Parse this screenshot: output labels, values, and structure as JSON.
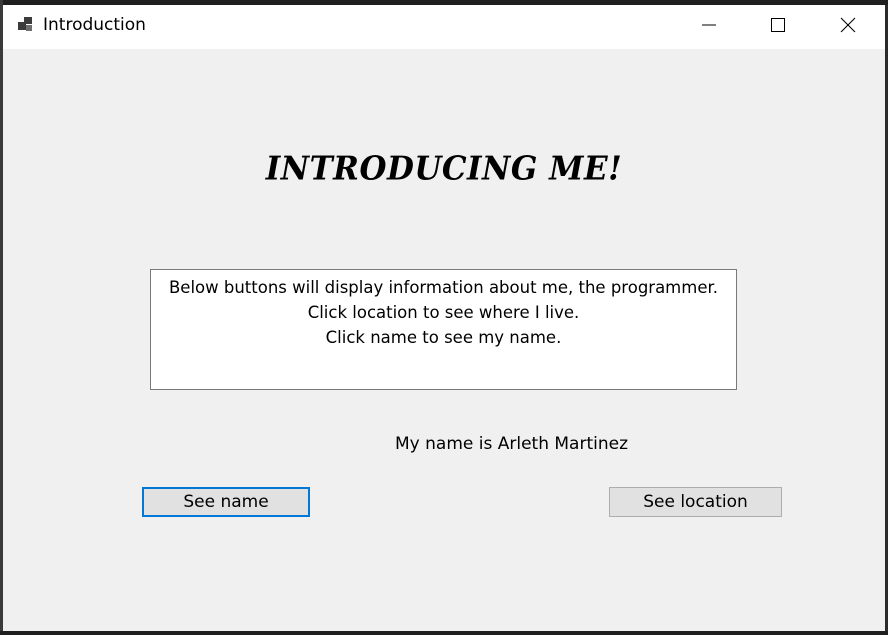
{
  "window": {
    "title": "Introduction",
    "controls": {
      "minimize_icon": "minimize-icon",
      "maximize_icon": "maximize-icon",
      "close_icon": "close-icon"
    }
  },
  "main": {
    "heading": "INTRODUCING ME!",
    "info_lines": [
      "Below buttons will display information about me, the programmer.",
      "Click location to see where I live.",
      "Click name to see my name."
    ],
    "result_label": "My name is Arleth Martinez",
    "buttons": {
      "see_name": "See name",
      "see_location": "See location"
    }
  },
  "colors": {
    "focus_border": "#0078d7",
    "form_background": "#f0f0f0",
    "button_background": "#e1e1e1"
  }
}
